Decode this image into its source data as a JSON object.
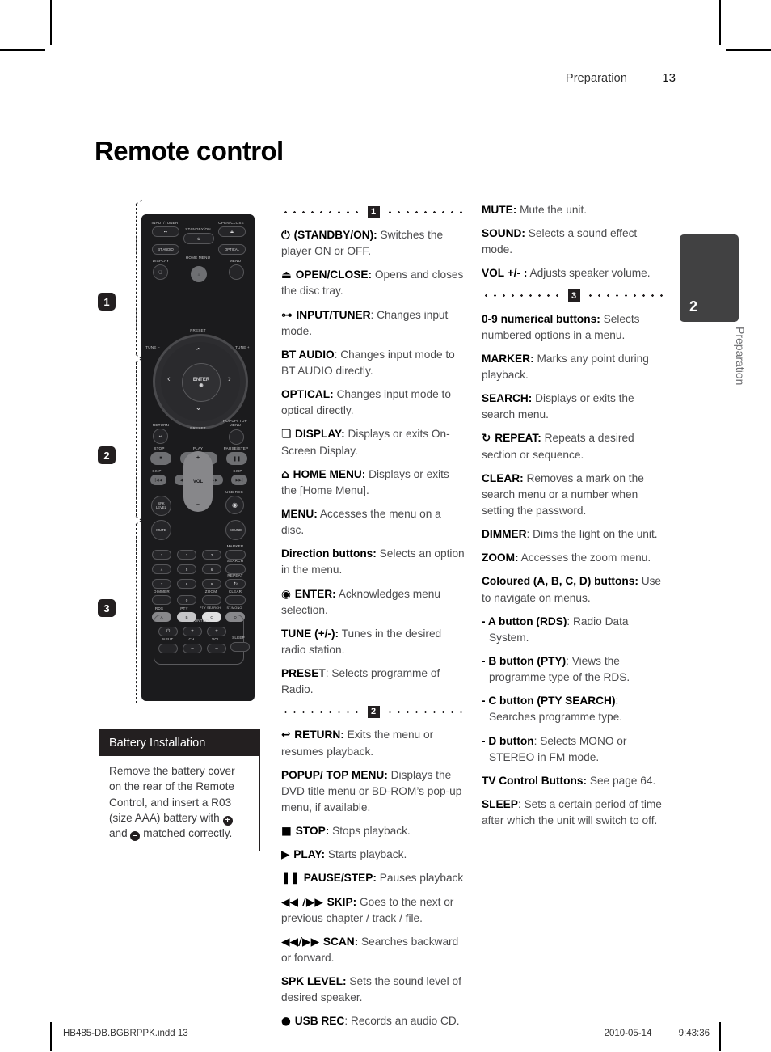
{
  "header": {
    "section": "Preparation",
    "page_number": "13"
  },
  "page_title": "Remote control",
  "side_tab": {
    "number": "2",
    "label": "Preparation"
  },
  "callouts": {
    "one": "1",
    "two": "2",
    "three": "3"
  },
  "battery": {
    "title": "Battery Installation",
    "body_1": "Remove the battery cover on the rear of the Remote Control, and insert a R03 (size AAA) battery with ",
    "plus": "+",
    "body_2": " and ",
    "minus": "–",
    "body_3": " matched correctly."
  },
  "remote": {
    "labels": [
      "INPUT/TUNER",
      "STANDBY/ON",
      "OPEN/CLOSE",
      "BT AUDIO",
      "OPTICAL",
      "DISPLAY",
      "HOME MENU",
      "MENU",
      "PRESET",
      "TUNE –",
      "TUNE +",
      "ENTER",
      "RETURN",
      "POPUP/ TOP MENU",
      "STOP",
      "PLAY",
      "PAUSE/STEP",
      "SKIP",
      "SCAN",
      "SKIP",
      "SPK LEVEL",
      "VOL",
      "USB REC",
      "MUTE",
      "SOUND",
      "MARKER",
      "SEARCH",
      "REPEAT",
      "DIMMER",
      "ZOOM",
      "CLEAR",
      "RDS",
      "PTY",
      "PTY SEARCH",
      "ST/MONO",
      "TV CONTROL",
      "INPUT",
      "CH",
      "SLEEP"
    ],
    "numbers": [
      "1",
      "2",
      "3",
      "4",
      "5",
      "6",
      "7",
      "8",
      "9",
      "0"
    ],
    "colour_buttons": [
      "A",
      "B",
      "C",
      "D"
    ]
  },
  "column_1": [
    {
      "type": "divider",
      "num": "1"
    },
    {
      "icon": "⏻",
      "term": "(STANDBY/ON):",
      "text": " Switches the player ON or OFF."
    },
    {
      "icon": "⏏",
      "term": "OPEN/CLOSE:",
      "text": " Opens and closes the disc tray."
    },
    {
      "icon": "⊶",
      "term": "INPUT/TUNER",
      "text": ": Changes input mode."
    },
    {
      "icon": "",
      "term": "BT AUDIO",
      "text": ": Changes input mode to BT AUDIO directly."
    },
    {
      "icon": "",
      "term": "OPTICAL:",
      "text": " Changes input mode to optical directly."
    },
    {
      "icon": "❏",
      "term": "DISPLAY:",
      "text": " Displays or exits On-Screen Display."
    },
    {
      "icon": "⌂",
      "term": "HOME MENU:",
      "text": " Displays or exits the [Home Menu]."
    },
    {
      "icon": "",
      "term": "MENU:",
      "text": " Accesses the menu on a disc."
    },
    {
      "icon": "",
      "term": "Direction buttons:",
      "text": " Selects an option in the menu."
    },
    {
      "icon": "◉",
      "term": "ENTER:",
      "text": " Acknowledges menu selection."
    },
    {
      "icon": "",
      "term": "TUNE (+/-):",
      "text": " Tunes in the desired radio station."
    },
    {
      "icon": "",
      "term": "PRESET",
      "text": ": Selects programme of Radio."
    },
    {
      "type": "divider",
      "num": "2"
    },
    {
      "icon": "↩",
      "term": "RETURN:",
      "text": " Exits the menu or resumes playback."
    },
    {
      "icon": "",
      "term": "POPUP/ TOP MENU:",
      "text": " Displays the DVD title menu or BD-ROM’s pop-up menu, if available."
    },
    {
      "icon": "■",
      "term": "STOP:",
      "text": " Stops playback."
    },
    {
      "icon": "▶",
      "term": "PLAY:",
      "text": " Starts playback."
    },
    {
      "icon": "❚❚",
      "term": "PAUSE/STEP:",
      "text": " Pauses playback"
    },
    {
      "icon": "◀◀ /▶▶",
      "term": "SKIP:",
      "text": " Goes to the next or previous chapter / track / file."
    },
    {
      "icon": "◀◀/▶▶",
      "term": "SCAN:",
      "text": " Searches backward or forward."
    },
    {
      "icon": "",
      "term": "SPK LEVEL:",
      "text": " Sets the sound level of desired speaker."
    },
    {
      "icon": "●",
      "term": "USB REC",
      "text": ": Records an audio CD."
    }
  ],
  "column_2": [
    {
      "icon": "",
      "term": "MUTE:",
      "text": " Mute the unit."
    },
    {
      "icon": "",
      "term": "SOUND:",
      "text": " Selects a sound effect mode."
    },
    {
      "icon": "",
      "term": "VOL +/- :",
      "text": " Adjusts speaker volume."
    },
    {
      "type": "divider",
      "num": "3"
    },
    {
      "icon": "",
      "term": "0-9 numerical buttons:",
      "text": " Selects numbered options in a menu."
    },
    {
      "icon": "",
      "term": "MARKER:",
      "text": " Marks any point during playback."
    },
    {
      "icon": "",
      "term": "SEARCH:",
      "text": " Displays or exits the search menu."
    },
    {
      "icon": "↻",
      "term": "REPEAT:",
      "text": " Repeats a desired section or sequence."
    },
    {
      "icon": "",
      "term": "CLEAR:",
      "text": " Removes a mark on the search menu or a number when setting the password."
    },
    {
      "icon": "",
      "term": "DIMMER",
      "text": ": Dims the light on the unit."
    },
    {
      "icon": "",
      "term": "ZOOM:",
      "text": " Accesses the zoom menu."
    },
    {
      "icon": "",
      "term": "Coloured (A, B, C, D) buttons:",
      "text": " Use to navigate on menus."
    },
    {
      "sub": true,
      "icon": "",
      "term": "- A button (RDS)",
      "text": ": Radio Data System."
    },
    {
      "sub": true,
      "icon": "",
      "term": "- B button (PTY)",
      "text": ": Views the programme type of the RDS."
    },
    {
      "sub": true,
      "icon": "",
      "term": "- C button (PTY SEARCH)",
      "text": ": Searches programme type."
    },
    {
      "sub": true,
      "icon": "",
      "term": "- D button",
      "text": ": Selects MONO or STEREO in FM mode."
    },
    {
      "icon": "",
      "term": "TV Control Buttons:",
      "text": " See page 64."
    },
    {
      "icon": "",
      "term": "SLEEP",
      "text": ": Sets a certain period of time after which the unit will switch to off."
    }
  ],
  "footer": {
    "file": "HB485-DB.BGBRPPK.indd   13",
    "date": "2010-05-14",
    "time": "9:43:36"
  }
}
